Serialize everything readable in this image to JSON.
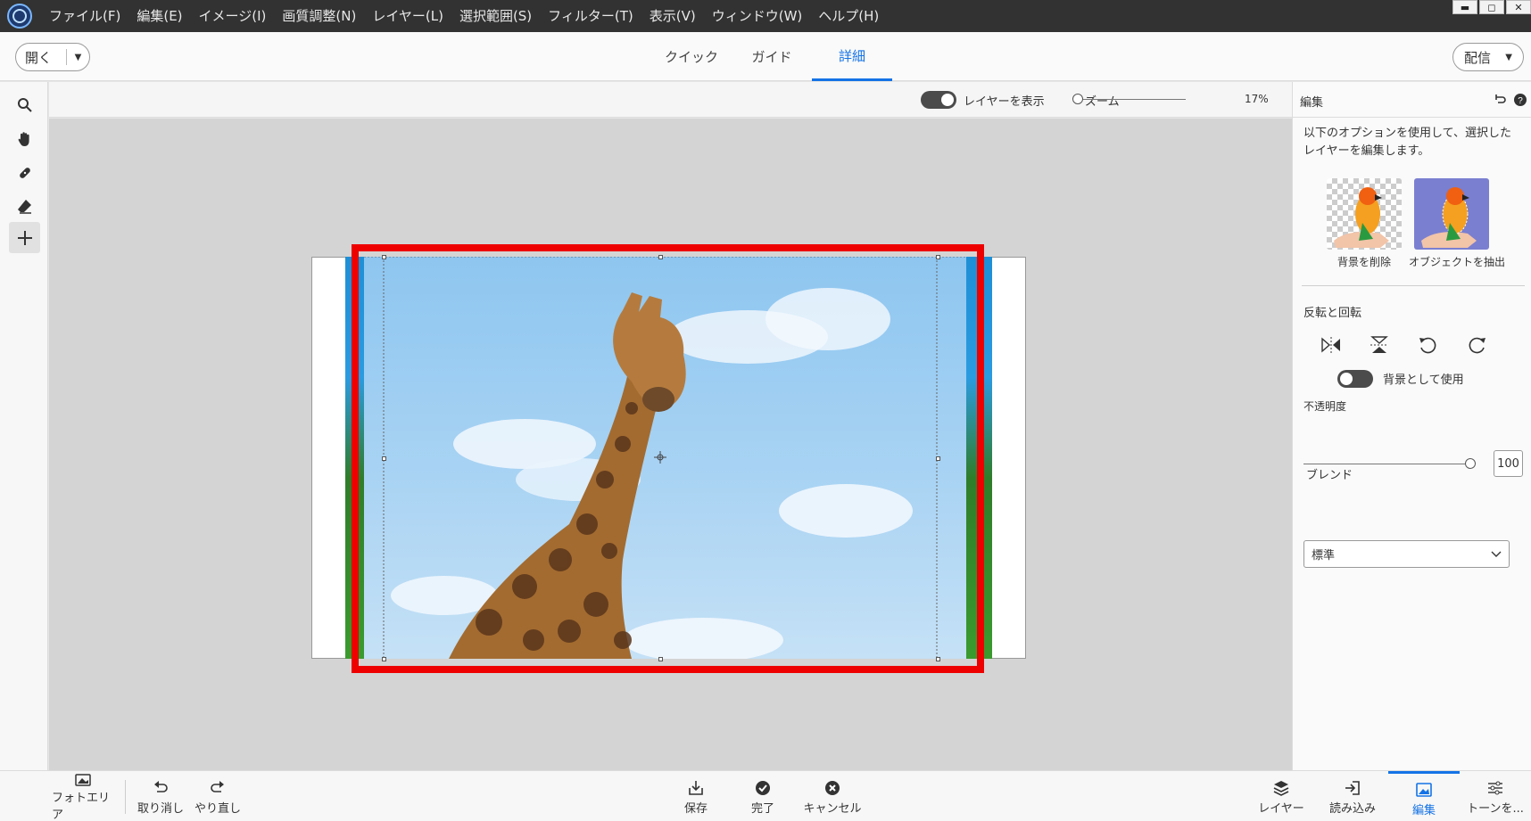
{
  "menubar": {
    "items": [
      "ファイル(F)",
      "編集(E)",
      "イメージ(I)",
      "画質調整(N)",
      "レイヤー(L)",
      "選択範囲(S)",
      "フィルター(T)",
      "表示(V)",
      "ウィンドウ(W)",
      "ヘルプ(H)"
    ],
    "controls": [
      "▬",
      "◻",
      "✕"
    ]
  },
  "modebar": {
    "open_label": "開く",
    "tabs": [
      "クイック",
      "ガイド",
      "詳細"
    ],
    "active_tab": "詳細",
    "share_label": "配信"
  },
  "toolbar": {
    "tools": [
      "zoom-tool",
      "hand-tool",
      "healing-brush-tool",
      "eraser-tool",
      "move-tool"
    ],
    "active_tool": "move-tool"
  },
  "options": {
    "show_layers_label": "レイヤーを表示",
    "show_layers_on": true,
    "zoom_label": "ズーム",
    "zoom_value": "17%"
  },
  "panel": {
    "title": "編集",
    "description": "以下のオプションを使用して、選択したレイヤーを編集します。",
    "remove_bg_label": "背景を削除",
    "extract_object_label": "オブジェクトを抽出",
    "flip_rotate_title": "反転と回転",
    "use_as_bg_label": "背景として使用",
    "use_as_bg_on": false,
    "opacity_label": "不透明度",
    "opacity_value": "100",
    "opacity_fraction": 1.0,
    "blend_label": "ブレンド",
    "blend_value": "標準"
  },
  "bottombar": {
    "photo_bin": "フォトエリア",
    "undo": "取り消し",
    "redo": "やり直し",
    "save": "保存",
    "done": "完了",
    "cancel": "キャンセル",
    "layers": "レイヤー",
    "import": "読み込み",
    "edit": "編集",
    "tone": "トーンを..."
  },
  "colors": {
    "accent": "#1473e6",
    "highlight": "#ee0000",
    "menubar_bg": "#323232"
  }
}
